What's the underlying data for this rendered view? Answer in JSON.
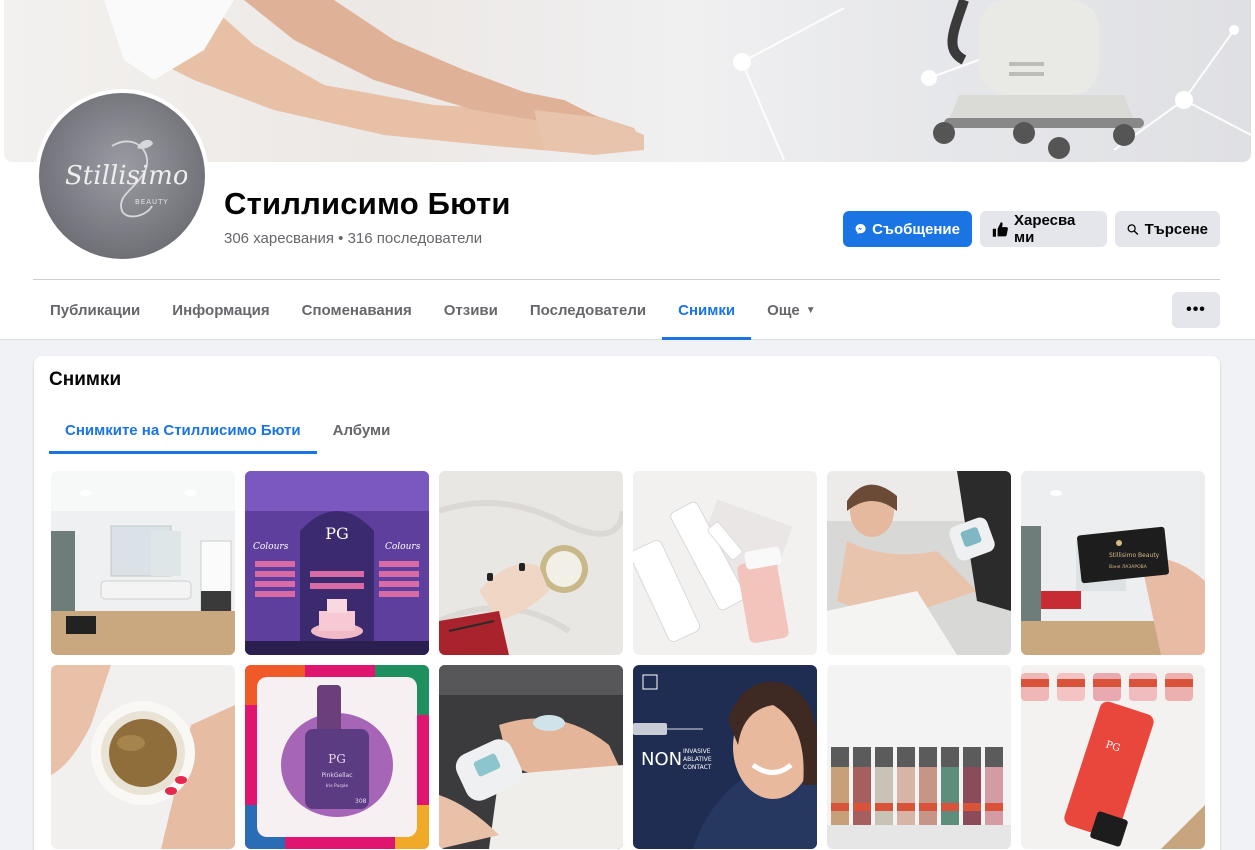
{
  "page": {
    "name": "Стиллисимо Бюти",
    "stats": "306 харесвания • 316 последователи",
    "logo_text": "Stillisimo",
    "logo_sub": "beauty"
  },
  "actions": {
    "message": "Съобщение",
    "like": "Харесва ми",
    "search": "Търсене"
  },
  "nav": {
    "tabs": [
      {
        "label": "Публикации"
      },
      {
        "label": "Информация"
      },
      {
        "label": "Споменавания"
      },
      {
        "label": "Отзиви"
      },
      {
        "label": "Последователи"
      },
      {
        "label": "Снимки"
      },
      {
        "label": "Още"
      }
    ],
    "active": "Снимки",
    "more_menu_icon": "ellipsis-icon"
  },
  "photos_section": {
    "title": "Снимки",
    "subtabs": [
      {
        "label": "Снимките на Стиллисимо Бюти"
      },
      {
        "label": "Албуми"
      }
    ],
    "active_subtab": "Снимките на Стиллисимо Бюти"
  },
  "photo_texts": {
    "pg_logo": "PG",
    "colours": "Colours",
    "business_card_name": "Stillisimo Beauty",
    "business_card_person": "Ваня ЛАЗАРОВА",
    "non_word": "NON",
    "non_lines": [
      "INVASIVE",
      "ABLATIVE",
      "CONTACT"
    ],
    "gel_brand": "PinkGellac",
    "gel_shade": "Iris Purple",
    "gel_number": "308"
  },
  "colors": {
    "accent": "#1b74e4",
    "secondary_button": "#e4e6eb",
    "background": "#f0f2f5"
  }
}
